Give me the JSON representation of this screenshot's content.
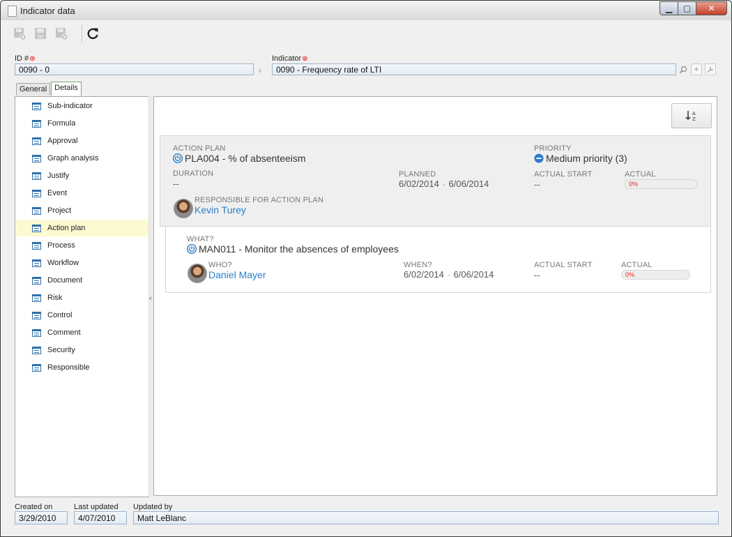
{
  "window": {
    "title": "Indicator data"
  },
  "toolbar": {
    "buttons": [
      {
        "icon": "save-new-icon",
        "enabled": false
      },
      {
        "icon": "save-icon",
        "enabled": false
      },
      {
        "icon": "save-close-icon",
        "enabled": false
      },
      {
        "icon": "refresh-icon",
        "enabled": true
      }
    ]
  },
  "form": {
    "id_label": "ID #",
    "id_value": "0090 - 0",
    "indicator_label": "Indicator",
    "indicator_value": "0090 - Frequency rate of LTI"
  },
  "tabs": [
    {
      "label": "General",
      "active": false
    },
    {
      "label": "Details",
      "active": true
    }
  ],
  "nav": {
    "selected": "Action plan",
    "items": [
      "Sub-indicator",
      "Formula",
      "Approval",
      "Graph analysis",
      "Justify",
      "Event",
      "Project",
      "Action plan",
      "Process",
      "Workflow",
      "Document",
      "Risk",
      "Control",
      "Comment",
      "Security",
      "Responsible"
    ]
  },
  "action_plan": {
    "caption": "ACTION PLAN",
    "name": "PLA004 - % of absenteeism",
    "priority_caption": "PRIORITY",
    "priority": "Medium priority (3)",
    "duration_caption": "DURATION",
    "duration": "--",
    "planned_caption": "PLANNED",
    "planned_start": "6/02/2014",
    "planned_sep": "-",
    "planned_end": "6/06/2014",
    "actual_start_caption": "ACTUAL START",
    "actual_start": "--",
    "actual_caption": "ACTUAL",
    "actual_progress": "0%",
    "responsible_caption": "RESPONSIBLE FOR ACTION PLAN",
    "responsible": "Kevin Turey"
  },
  "action": {
    "what_caption": "WHAT?",
    "what": "MAN011 - Monitor the absences of employees",
    "who_caption": "WHO?",
    "who": "Daniel Mayer",
    "when_caption": "WHEN?",
    "when_start": "6/02/2014",
    "when_sep": "-",
    "when_end": "6/06/2014",
    "actual_start_caption": "ACTUAL START",
    "actual_start": "--",
    "actual_caption": "ACTUAL",
    "actual_progress": "0%"
  },
  "footer": {
    "created_label": "Created on",
    "created_value": "3/29/2010",
    "updated_label": "Last updated",
    "updated_value": "4/07/2010",
    "updated_by_label": "Updated by",
    "updated_by_value": "Matt LeBlanc"
  }
}
